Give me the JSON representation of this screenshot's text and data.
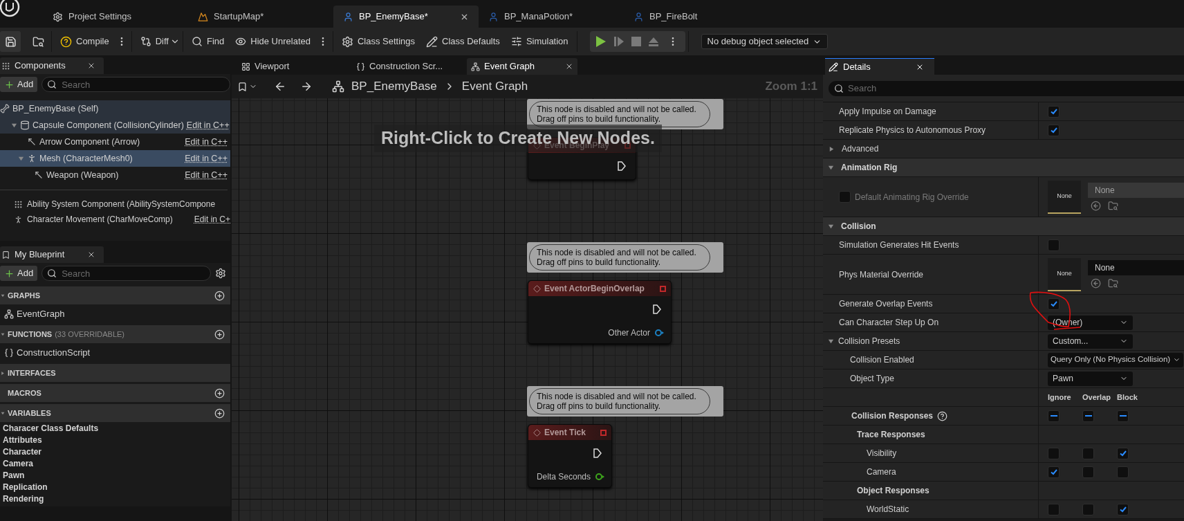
{
  "asset_tabs": [
    {
      "label": "Project Settings",
      "selected": false
    },
    {
      "label": "StartupMap*",
      "selected": false
    },
    {
      "label": "BP_EnemyBase*",
      "selected": true
    },
    {
      "label": "BP_ManaPotion*",
      "selected": false
    },
    {
      "label": "BP_FireBolt",
      "selected": false
    }
  ],
  "toolbar": {
    "compile": "Compile",
    "diff": "Diff",
    "find": "Find",
    "hide_unrelated": "Hide Unrelated",
    "class_settings": "Class Settings",
    "class_defaults": "Class Defaults",
    "simulation": "Simulation",
    "debug_filter": "No debug object selected"
  },
  "components": {
    "tab": "Components",
    "add": "Add",
    "search_placeholder": "Search",
    "tree": [
      {
        "name": "BP_EnemyBase (Self)",
        "selected": false,
        "highlighted": true,
        "children": [
          {
            "name": "Capsule Component (CollisionCylinder)",
            "link": "Edit in C++",
            "selected": false,
            "highlighted": true,
            "expanded": true,
            "children": [
              {
                "name": "Arrow Component (Arrow)",
                "link": "Edit in C++",
                "selected": false,
                "highlighted": false
              },
              {
                "name": "Mesh (CharacterMesh0)",
                "link": "Edit in C++",
                "selected": true,
                "expanded": true,
                "children": [
                  {
                    "name": "Weapon (Weapon)",
                    "link": "Edit in C++",
                    "selected": false,
                    "highlighted": false
                  }
                ]
              }
            ]
          }
        ]
      }
    ],
    "other": [
      {
        "name": "Ability System Component (AbilitySystemCompone",
        "selected": false
      },
      {
        "name": "Character Movement (CharMoveComp)",
        "link": "Edit in C+",
        "selected": false
      }
    ]
  },
  "my_blueprint": {
    "tab": "My Blueprint",
    "add": "Add",
    "search_placeholder": "Search",
    "sections": [
      {
        "title": "GRAPHS",
        "expanded": true,
        "addable": true,
        "items": [
          {
            "name": "EventGraph",
            "kind": "graph"
          }
        ]
      },
      {
        "title": "FUNCTIONS",
        "note": "(33 OVERRIDABLE)",
        "expanded": true,
        "addable": true,
        "items": [
          {
            "name": "ConstructionScript",
            "kind": "function"
          }
        ]
      },
      {
        "title": "INTERFACES",
        "expanded": false,
        "addable": false
      },
      {
        "title": "MACROS",
        "addable": true
      },
      {
        "title": "VARIABLES",
        "expanded": true,
        "addable": true,
        "items": [
          {
            "name": "Characer Class Defaults",
            "kind": "category"
          },
          {
            "name": "Attributes",
            "kind": "category"
          },
          {
            "name": "Character",
            "kind": "category"
          },
          {
            "name": "Camera",
            "kind": "category"
          },
          {
            "name": "Pawn",
            "kind": "category"
          },
          {
            "name": "Replication",
            "kind": "category"
          },
          {
            "name": "Rendering",
            "kind": "category"
          }
        ]
      }
    ]
  },
  "graph_editor": {
    "tabs": [
      {
        "label": "Viewport",
        "selected": false
      },
      {
        "label": "Construction Scr...",
        "selected": false
      },
      {
        "label": "Event Graph",
        "selected": true
      }
    ],
    "breadcrumb": [
      "BP_EnemyBase",
      "Event Graph"
    ],
    "zoom": "Zoom 1:1",
    "hint": "Right-Click to Create New Nodes.",
    "nodes": [
      {
        "comment": "This node is disabled and will not be called. Drag off pins to build functionality.",
        "title": "Event BeginPlay",
        "disabled": true
      },
      {
        "comment": "This node is disabled and will not be called. Drag off pins to build functionality.",
        "title": "Event ActorBeginOverlap",
        "disabled": true,
        "pins": [
          {
            "label": "Other Actor",
            "color": "#1c82c4"
          }
        ]
      },
      {
        "comment": "This node is disabled and will not be called. Drag off pins to build functionality.",
        "title": "Event Tick",
        "disabled": true,
        "pins": [
          {
            "label": "Delta Seconds",
            "color": "#3ea61c"
          }
        ]
      }
    ]
  },
  "details": {
    "tab": "Details",
    "search_placeholder": "Search",
    "rows": [
      {
        "kind": "checkbox",
        "label": "Apply Impulse on Damage",
        "checked": true
      },
      {
        "kind": "checkbox",
        "label": "Replicate Physics to Autonomous Proxy",
        "checked": true
      },
      {
        "kind": "group",
        "label": "Advanced",
        "expanded": false
      },
      {
        "kind": "section",
        "label": "Animation Rig",
        "expanded": true
      },
      {
        "kind": "asset",
        "label": "Default Animating Rig Override",
        "override": false,
        "disabled": true,
        "thumb": "None",
        "value": "None"
      },
      {
        "kind": "section",
        "label": "Collision",
        "expanded": true
      },
      {
        "kind": "checkbox",
        "label": "Simulation Generates Hit Events",
        "checked": false
      },
      {
        "kind": "asset",
        "label": "Phys Material Override",
        "disabled": false,
        "thumb": "None",
        "value": "None"
      },
      {
        "kind": "checkbox",
        "label": "Generate Overlap Events",
        "checked": true
      },
      {
        "kind": "dropdown",
        "label": "Can Character Step Up On",
        "value": "(Owner)"
      },
      {
        "kind": "dropdown",
        "label": "Collision Presets",
        "value": "Custom...",
        "expanded": true,
        "children": [
          {
            "kind": "dropdown",
            "label": "Collision Enabled",
            "value": "Query Only (No Physics Collision)"
          },
          {
            "kind": "dropdown",
            "label": "Object Type",
            "value": "Pawn"
          },
          {
            "kind": "columns",
            "columns": [
              "Ignore",
              "Overlap",
              "Block"
            ]
          },
          {
            "kind": "summary",
            "label": "Collision Responses",
            "responses": [
              {
                "mixed": true
              },
              {
                "mixed": true
              },
              {
                "mixed": true
              }
            ]
          },
          {
            "kind": "subheader",
            "label": "Trace Responses",
            "children": [
              {
                "kind": "responses",
                "label": "Visibility",
                "responses": [
                  {
                    "checked": false
                  },
                  {
                    "checked": false
                  },
                  {
                    "checked": true
                  }
                ]
              },
              {
                "kind": "responses",
                "label": "Camera",
                "responses": [
                  {
                    "checked": true
                  },
                  {
                    "checked": false
                  },
                  {
                    "checked": false
                  }
                ]
              }
            ]
          },
          {
            "kind": "subheader",
            "label": "Object Responses",
            "children": [
              {
                "kind": "responses",
                "label": "WorldStatic",
                "responses": [
                  {
                    "checked": false
                  },
                  {
                    "checked": false
                  },
                  {
                    "checked": true
                  }
                ]
              }
            ]
          }
        ]
      }
    ]
  }
}
